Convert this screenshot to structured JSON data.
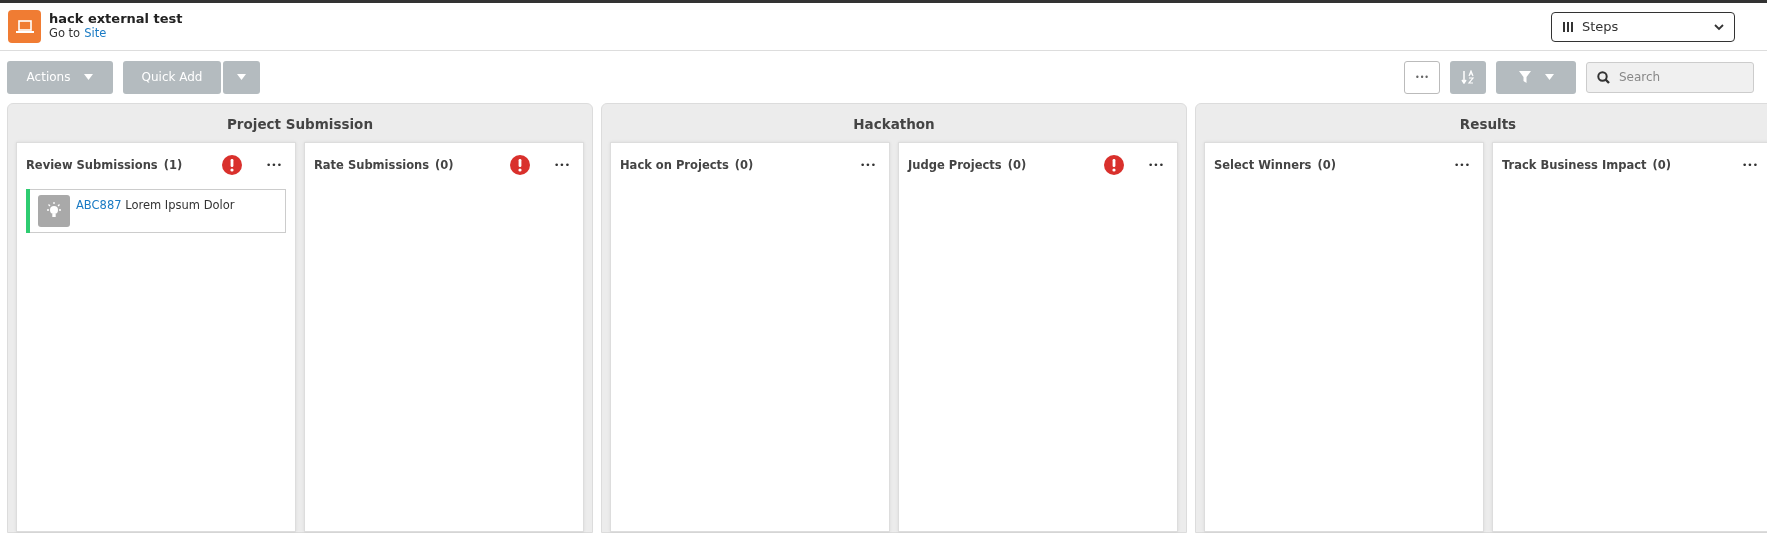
{
  "header": {
    "title": "hack external test",
    "subtitle": "Go to",
    "link": "Site"
  },
  "view_select": {
    "value": "Steps"
  },
  "toolbar": {
    "actions": "Actions",
    "quick_add": "Quick Add",
    "more": "•••",
    "search": {
      "placeholder": "Search"
    }
  },
  "stages": [
    {
      "title": "Project Submission",
      "columns": [
        {
          "title": "Review Submissions",
          "count": "(1)",
          "warning": true,
          "more": "•••",
          "cards": [
            {
              "id": "ABC887",
              "text": "Lorem Ipsum Dolor",
              "color": "#2ecc71"
            }
          ]
        },
        {
          "title": "Rate Submissions",
          "count": "(0)",
          "warning": true,
          "more": "•••"
        }
      ]
    },
    {
      "title": "Hackathon",
      "columns": [
        {
          "title": "Hack on Projects",
          "count": "(0)",
          "warning": false,
          "more": "•••"
        },
        {
          "title": "Judge Projects",
          "count": "(0)",
          "warning": true,
          "more": "•••"
        }
      ]
    },
    {
      "title": "Results",
      "columns": [
        {
          "title": "Select Winners",
          "count": "(0)",
          "warning": false,
          "more": "•••"
        },
        {
          "title": "Track Business Impact",
          "count": "(0)",
          "warning": false,
          "more": "•••"
        }
      ]
    }
  ]
}
